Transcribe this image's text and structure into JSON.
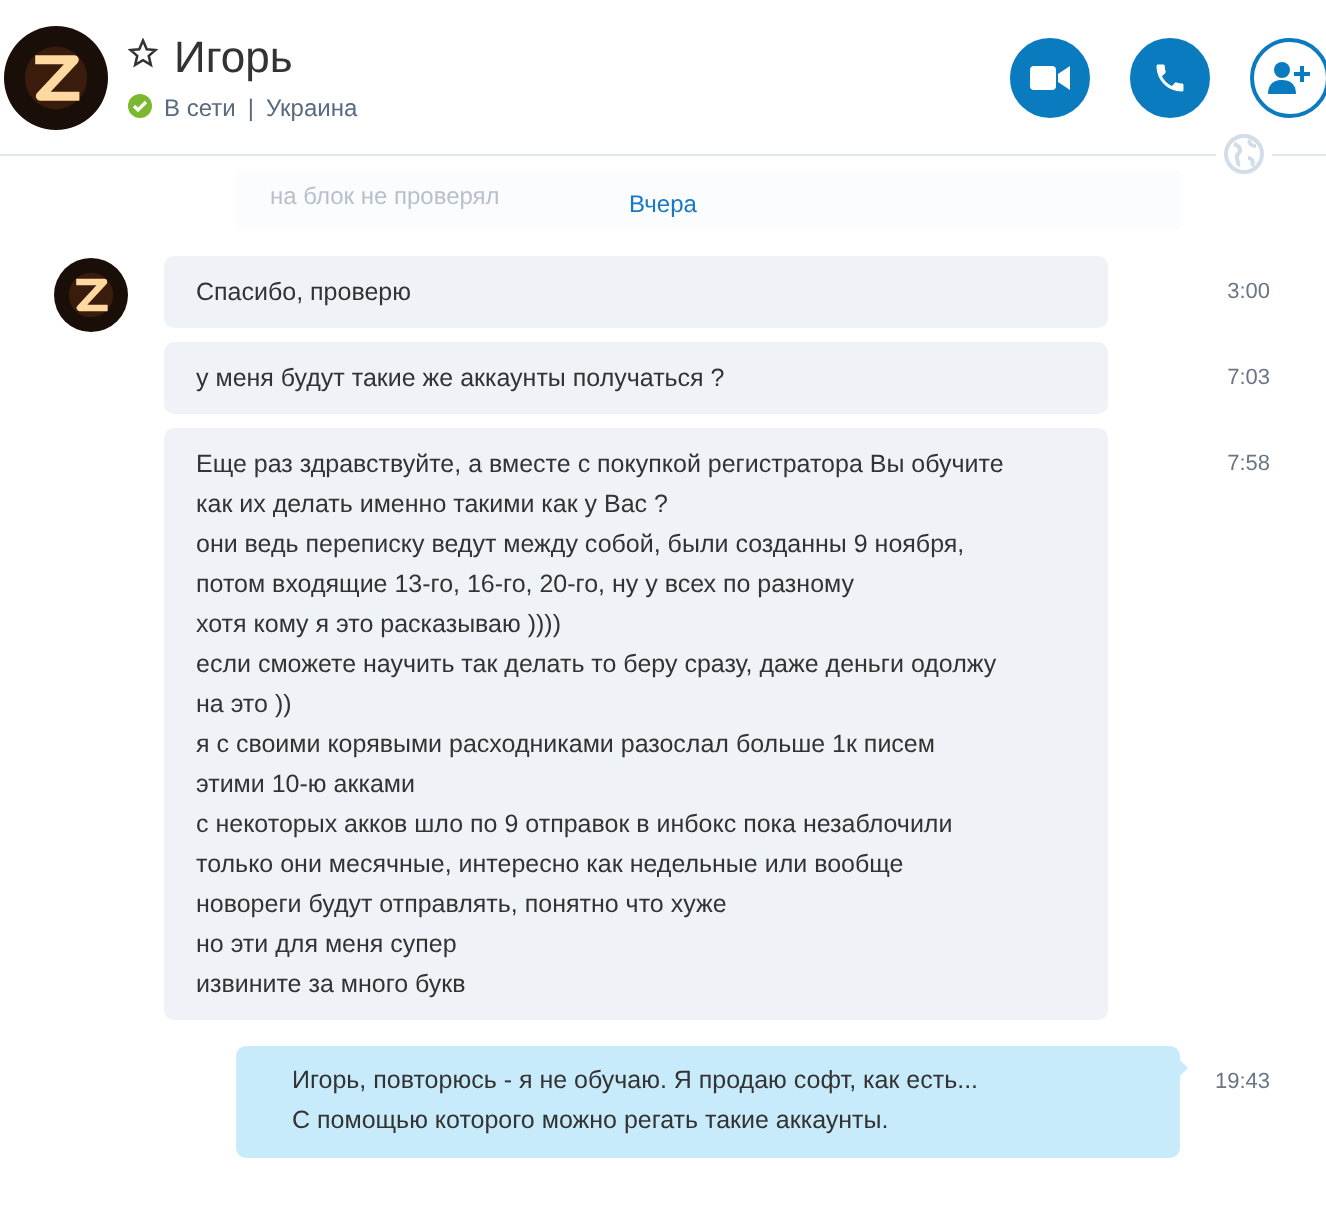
{
  "contact": {
    "name": "Игорь",
    "favorite": false,
    "status": "В сети",
    "separator": "|",
    "location": "Украина",
    "online": true
  },
  "header_buttons": [
    {
      "kind": "video"
    },
    {
      "kind": "call"
    },
    {
      "kind": "add-person"
    }
  ],
  "faded_text": "на блок не проверял",
  "date_label": "Вчера",
  "messages": [
    {
      "kind": "incoming",
      "show_avatar": true,
      "text": "Спасибо, проверю",
      "time": "3:00"
    },
    {
      "kind": "incoming",
      "show_avatar": false,
      "text": "у меня будут такие же аккаунты получаться ?",
      "time": "7:03"
    },
    {
      "kind": "incoming",
      "show_avatar": false,
      "text": "Еще раз здравствуйте, а вместе с покупкой регистратора Вы обучите\nкак их делать именно такими как у Вас ?\nони ведь переписку ведут между собой, были созданны 9 ноября,\nпотом входящие 13-го, 16-го, 20-го, ну у всех по разному\nхотя кому я это расказываю ))))\nесли сможете научить так делать то беру сразу, даже деньги одолжу\nна это ))\nя с своими корявыми расходниками разослал больше 1к писем\nэтими 10-ю акками\nс некоторых акков шло по 9 отправок в инбокс пока незаблочили\nтолько они месячные, интересно как недельные или вообще\nновореги будут отправлять, понятно что хуже\nно эти для меня супер\nизвините за много букв",
      "time": "7:58"
    },
    {
      "kind": "outgoing",
      "show_avatar": false,
      "text": "Игорь, повторюсь - я не обучаю. Я продаю софт, как есть...\nС помощью которого можно регать такие аккаунты.",
      "time": "19:43"
    }
  ]
}
